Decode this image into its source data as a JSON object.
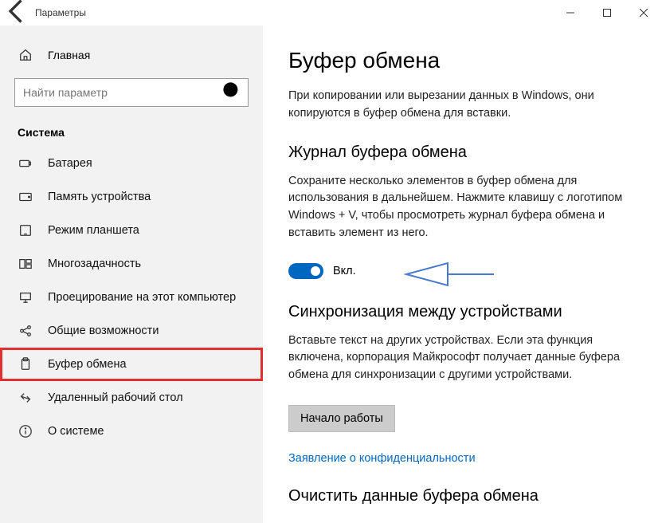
{
  "titlebar": {
    "title": "Параметры"
  },
  "sidebar": {
    "home": "Главная",
    "search_placeholder": "Найти параметр",
    "section": "Система",
    "items": [
      {
        "label": "Батарея"
      },
      {
        "label": "Память устройства"
      },
      {
        "label": "Режим планшета"
      },
      {
        "label": "Многозадачность"
      },
      {
        "label": "Проецирование на этот компьютер"
      },
      {
        "label": "Общие возможности"
      },
      {
        "label": "Буфер обмена"
      },
      {
        "label": "Удаленный рабочий стол"
      },
      {
        "label": "О системе"
      }
    ]
  },
  "main": {
    "title": "Буфер обмена",
    "intro": "При копировании или вырезании данных в Windows, они копируются в буфер обмена для вставки.",
    "history": {
      "heading": "Журнал буфера обмена",
      "desc": "Сохраните несколько элементов в буфер обмена для использования в дальнейшем. Нажмите клавишу с логотипом Windows + V, чтобы просмотреть журнал буфера обмена и вставить элемент из него.",
      "toggle_state": "Вкл."
    },
    "sync": {
      "heading": "Синхронизация между устройствами",
      "desc": "Вставьте текст на других устройствах. Если эта функция включена, корпорация Майкрософт получает данные буфера обмена для синхронизации с другими устройствами.",
      "button": "Начало работы"
    },
    "privacy_link": "Заявление о конфиденциальности",
    "clear": {
      "heading": "Очистить данные буфера обмена"
    }
  }
}
